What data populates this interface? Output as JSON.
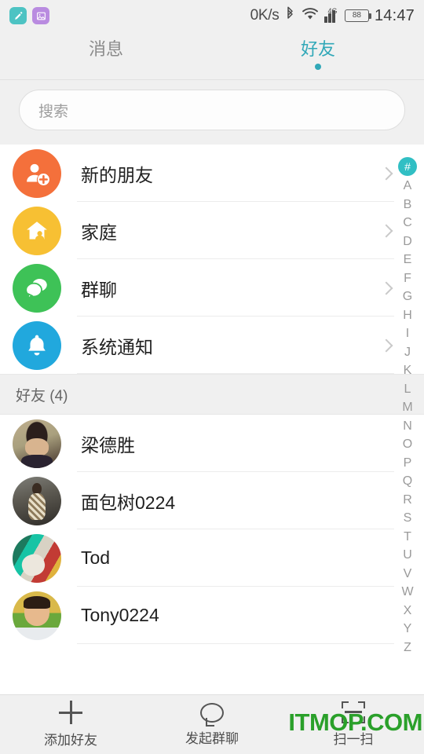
{
  "status_bar": {
    "edit_app_icon": "pencil-icon",
    "gallery_app_icon": "image-icon",
    "network_speed": "0K/s",
    "bluetooth_icon": "bluetooth-icon",
    "wifi_icon": "wifi-icon",
    "network_generation": "4G",
    "signal_icon": "signal-bars-icon",
    "battery_level": "88",
    "time": "14:47"
  },
  "tabs": [
    {
      "label": "消息",
      "active": false
    },
    {
      "label": "好友",
      "active": true
    }
  ],
  "search": {
    "placeholder": "搜索",
    "value": ""
  },
  "entries": [
    {
      "label": "新的朋友",
      "icon": "person-add-icon",
      "color": "#f4703b"
    },
    {
      "label": "家庭",
      "icon": "home-icon",
      "color": "#f7c033"
    },
    {
      "label": "群聊",
      "icon": "group-chat-icon",
      "color": "#3ec257"
    },
    {
      "label": "系统通知",
      "icon": "bell-icon",
      "color": "#21a8dd"
    }
  ],
  "friends_section": {
    "header": "好友 (4)",
    "count": 4,
    "items": [
      {
        "name": "梁德胜",
        "avatar": "photo-avatar-1"
      },
      {
        "name": "面包树0224",
        "avatar": "photo-avatar-2"
      },
      {
        "name": "Tod",
        "avatar": "photo-avatar-3"
      },
      {
        "name": "Tony0224",
        "avatar": "photo-avatar-4"
      }
    ]
  },
  "index_bar": {
    "selected": "#",
    "letters": [
      "#",
      "A",
      "B",
      "C",
      "D",
      "E",
      "F",
      "G",
      "H",
      "I",
      "J",
      "K",
      "L",
      "M",
      "N",
      "O",
      "P",
      "Q",
      "R",
      "S",
      "T",
      "U",
      "V",
      "W",
      "X",
      "Y",
      "Z"
    ],
    "selected_color": "#31bfc4"
  },
  "bottom_bar": [
    {
      "label": "添加好友",
      "icon": "plus-icon"
    },
    {
      "label": "发起群聊",
      "icon": "chat-bubble-icon"
    },
    {
      "label": "扫一扫",
      "icon": "scan-icon"
    }
  ],
  "watermark": {
    "text": "ITMOP.COM",
    "color": "#2aa02a"
  },
  "theme": {
    "accent": "#31a8b8",
    "page_bg": "#f0f0f0",
    "list_bg": "#ffffff"
  }
}
